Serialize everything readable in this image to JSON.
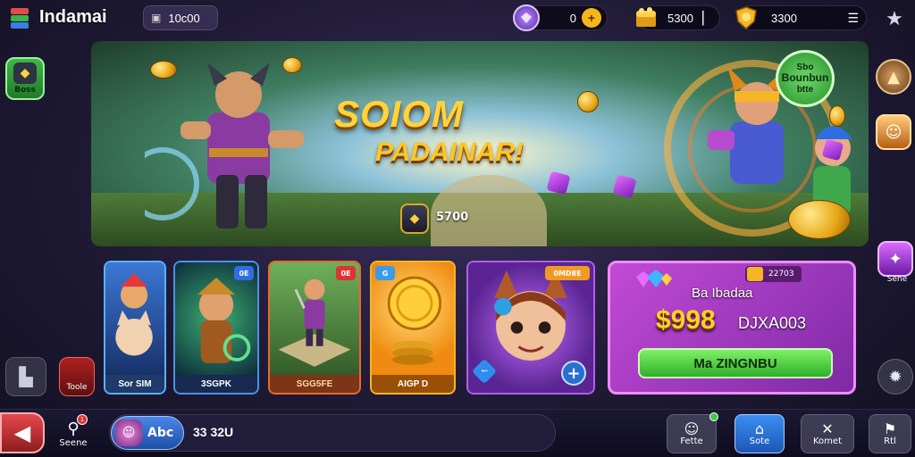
{
  "header": {
    "app_title": "Indamai",
    "player_id": "10c00",
    "currencies": [
      {
        "name": "gems",
        "value": "0",
        "icon": "gem-icon"
      },
      {
        "name": "gold",
        "value": "5300",
        "icon": "gold-chest-icon"
      },
      {
        "name": "coins",
        "value": "3300",
        "icon": "coin-shield-icon"
      }
    ]
  },
  "left_rail": {
    "top_label": "Boss",
    "red_label": "Toole"
  },
  "banner": {
    "title": "SOIOM",
    "subtitle": "PADAINAR!",
    "price": "5700"
  },
  "badge": {
    "line1": "Sbo",
    "line2": "Bounbun",
    "line3": "btte"
  },
  "right_rail": {
    "label": "Sene"
  },
  "cards": [
    {
      "label": "Sor SIM",
      "tag": ""
    },
    {
      "label": "3SGPK",
      "tag": "0E"
    },
    {
      "label": "SGG5FE",
      "tag": "0E"
    },
    {
      "label": "AIGP D",
      "tag": "G"
    },
    {
      "label": "",
      "tag": "0MD8E"
    }
  ],
  "offer": {
    "tag": "22703",
    "subtitle": "Ba Ibadaa",
    "price": "$998",
    "price_label": "DJXA003",
    "button": "Ma ZINGNBU"
  },
  "bottom": {
    "search_label": "Seene",
    "search_badge": "1",
    "player_name": "Abc",
    "player_score": "33 32U",
    "nav": [
      {
        "label": "Fette"
      },
      {
        "label": "Sote"
      },
      {
        "label": "Komet"
      },
      {
        "label": "Rtl"
      }
    ]
  },
  "colors": {
    "accent_gold": "#ffd33c",
    "accent_purple": "#c34ad6",
    "accent_green": "#2fae2a",
    "accent_blue": "#2a6fd0"
  }
}
